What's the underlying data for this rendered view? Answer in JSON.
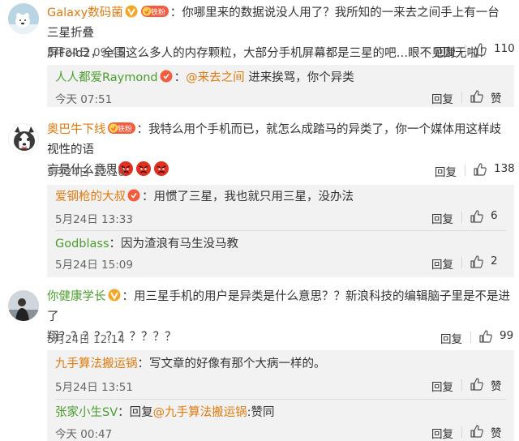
{
  "comments": [
    {
      "user": "Galaxy数码菌",
      "text": "：你哪里来的数据说没人用了？我所知的一来去之间手上有一台三星折叠屏Fold2，全国这么多人的内存颗粒，大部分手机屏幕都是三星的吧…眼不见则无啦！",
      "text_line1": "：你哪里来的数据说没人用了？我所知的一来去之间手上有一台三星折叠",
      "text_line2": "屏Fold2，全国这么多人的内存颗粒，大部分手机屏幕都是三星的吧…眼不见则无啦！",
      "time": "5月24日 09:45",
      "reply_label": "回复",
      "likes": "110",
      "replies": [
        {
          "user": "人人都爱Raymond",
          "mention": "@来去之间",
          "text": " 进来挨骂，你个异类",
          "time": "今天 07:51",
          "reply_label": "回复",
          "like_label": "赞"
        }
      ]
    },
    {
      "user": "奥巴牛下线",
      "text_line1": "：我特么用个手机而已，就怎么成踏马的异类了，你一个媒体用这样歧视性的语",
      "text_line2": "言是什么意思",
      "time": "5月24日 12:10",
      "reply_label": "回复",
      "likes": "138",
      "replies": [
        {
          "user": "爱钢枪的大叔",
          "text": "：用惯了三星，我也就只用三星，没办法",
          "time": "5月24日 13:33",
          "reply_label": "回复",
          "likes": "6"
        },
        {
          "user": "Godblass",
          "text": "：因为渣浪有马生没马教",
          "time": "5月24日 15:09",
          "reply_label": "回复",
          "likes": "2"
        }
      ]
    },
    {
      "user": "你健康学长",
      "text_line1": "：用三星手机的用户是异类是什么意思？？新浪科技的编辑脑子里是不是进了",
      "text_line2": "翔？？？？？？？？？？",
      "time": "5月24日 12:14",
      "reply_label": "回复",
      "likes": "99",
      "replies": [
        {
          "user": "九手算法搬运锅",
          "text": "：写文章的好像有那个大病一样的。",
          "time": "5月24日 13:51",
          "reply_label": "回复",
          "like_label": "赞"
        },
        {
          "user": "张家小生SV",
          "text_prefix": "：回复",
          "mention": "@九手算法搬运锅",
          "text": ":赞同",
          "time": "今天 00:47",
          "reply_label": "回复",
          "like_label": "赞"
        }
      ]
    }
  ],
  "badge_text": "铁粉",
  "colors": {
    "name": "#e07a0f",
    "green_name": "#4a9e2d",
    "subbox_bg": "#f2f2f2"
  },
  "icons": [
    "vip-v-icon",
    "fan-badge-icon",
    "thumb-up-icon",
    "angry-emoji-icon"
  ]
}
